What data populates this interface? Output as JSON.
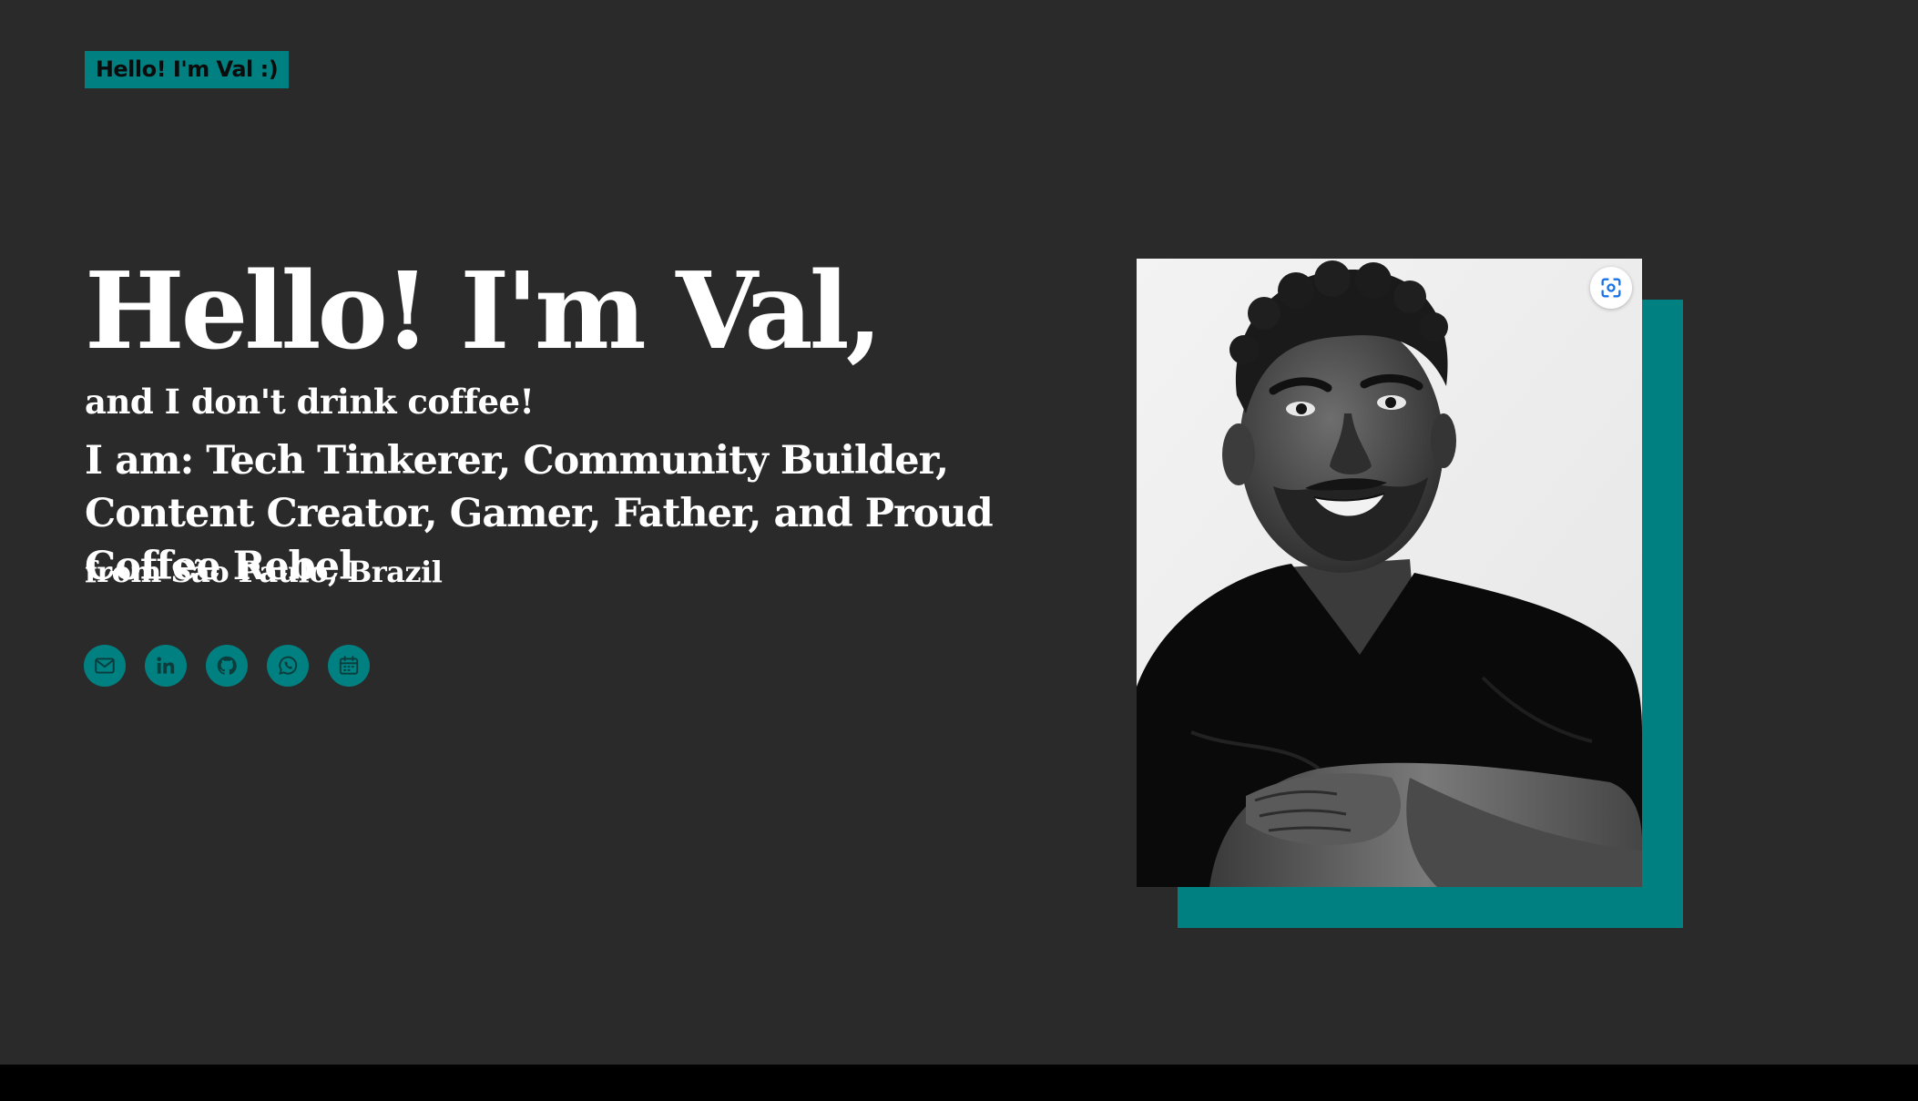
{
  "header": {
    "badge_label": "Hello! I'm Val :)"
  },
  "hero": {
    "title": "Hello! I'm Val,",
    "subtitle": "and I don't drink coffee!",
    "roles": "I am: Tech Tinkerer, Community Builder, Content Creator, Gamer, Father, and Proud Coffee Rebel",
    "location": "from São Paulo, Brazil"
  },
  "socials": [
    {
      "icon": "mail-icon"
    },
    {
      "icon": "linkedin-icon"
    },
    {
      "icon": "github-icon"
    },
    {
      "icon": "whatsapp-icon"
    },
    {
      "icon": "calendar-icon"
    }
  ],
  "photo": {
    "lens_icon": "visual-search-icon"
  },
  "colors": {
    "background": "#2a2a2a",
    "accent": "#008080",
    "text": "#ffffff",
    "footer_bar": "#000000"
  }
}
